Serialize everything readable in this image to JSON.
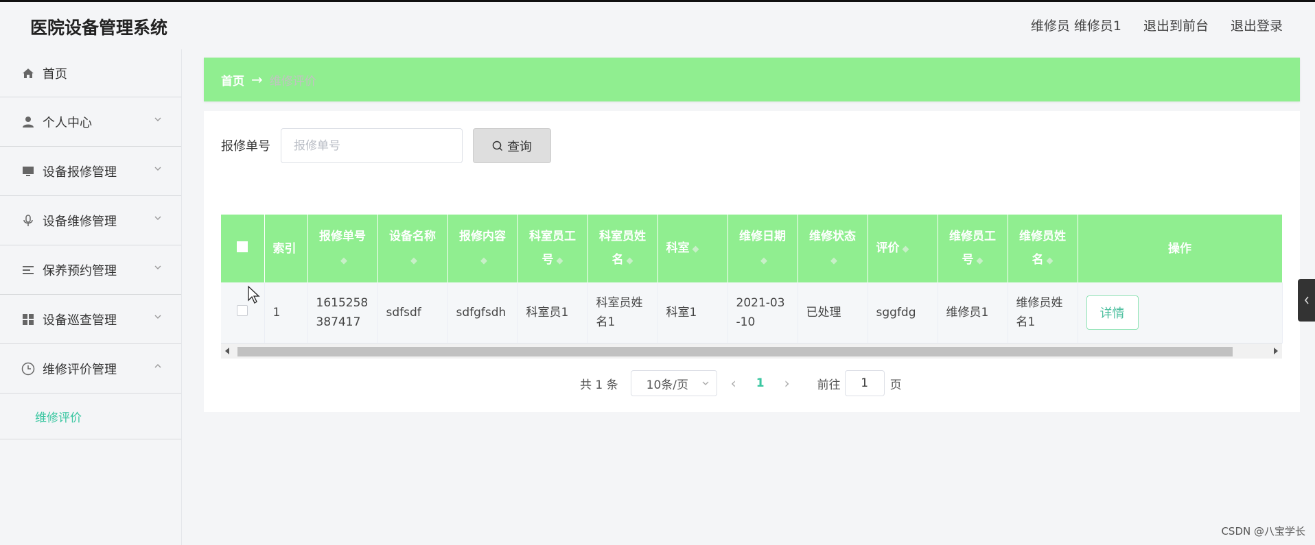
{
  "app": {
    "title": "医院设备管理系统"
  },
  "header": {
    "user_label": "维修员 维修员1",
    "back_front_label": "退出到前台",
    "logout_label": "退出登录"
  },
  "sidebar": {
    "items": [
      {
        "label": "首页",
        "icon": "home-icon"
      },
      {
        "label": "个人中心",
        "icon": "user-icon"
      },
      {
        "label": "设备报修管理",
        "icon": "monitor-icon"
      },
      {
        "label": "设备维修管理",
        "icon": "microphone-icon"
      },
      {
        "label": "保养预约管理",
        "icon": "list-icon"
      },
      {
        "label": "设备巡查管理",
        "icon": "grid-icon"
      },
      {
        "label": "维修评价管理",
        "icon": "clock-icon"
      }
    ],
    "subitem": "维修评价"
  },
  "breadcrumb": {
    "home": "首页",
    "separator": "→",
    "current": "维修评价"
  },
  "search": {
    "label": "报修单号",
    "placeholder": "报修单号",
    "button_label": "查询"
  },
  "table": {
    "columns": [
      "索引",
      "报修单号",
      "设备名称",
      "报修内容",
      "科室员工号",
      "科室员姓名",
      "科室",
      "维修日期",
      "维修状态",
      "评价",
      "维修员工号",
      "维修员姓名",
      "操作"
    ],
    "rows": [
      {
        "index": "1",
        "repair_no": "1615258387417",
        "device_name": "sdfsdf",
        "repair_content": "sdfgfsdh",
        "staff_no": "科室员1",
        "staff_name": "科室员姓名1",
        "department": "科室1",
        "repair_date": "2021-03-10",
        "status": "已处理",
        "evaluation": "sggfdg",
        "repairer_no": "维修员1",
        "repairer_name": "维修员姓名1",
        "action": "详情"
      }
    ]
  },
  "pagination": {
    "total": "共 1 条",
    "page_size": "10条/页",
    "current_page": "1",
    "goto_label": "前往",
    "goto_value": "1",
    "page_suffix": "页"
  },
  "watermark": "CSDN @八宝学长",
  "colors": {
    "accent": "#90ee90",
    "link": "#39c6a0"
  }
}
